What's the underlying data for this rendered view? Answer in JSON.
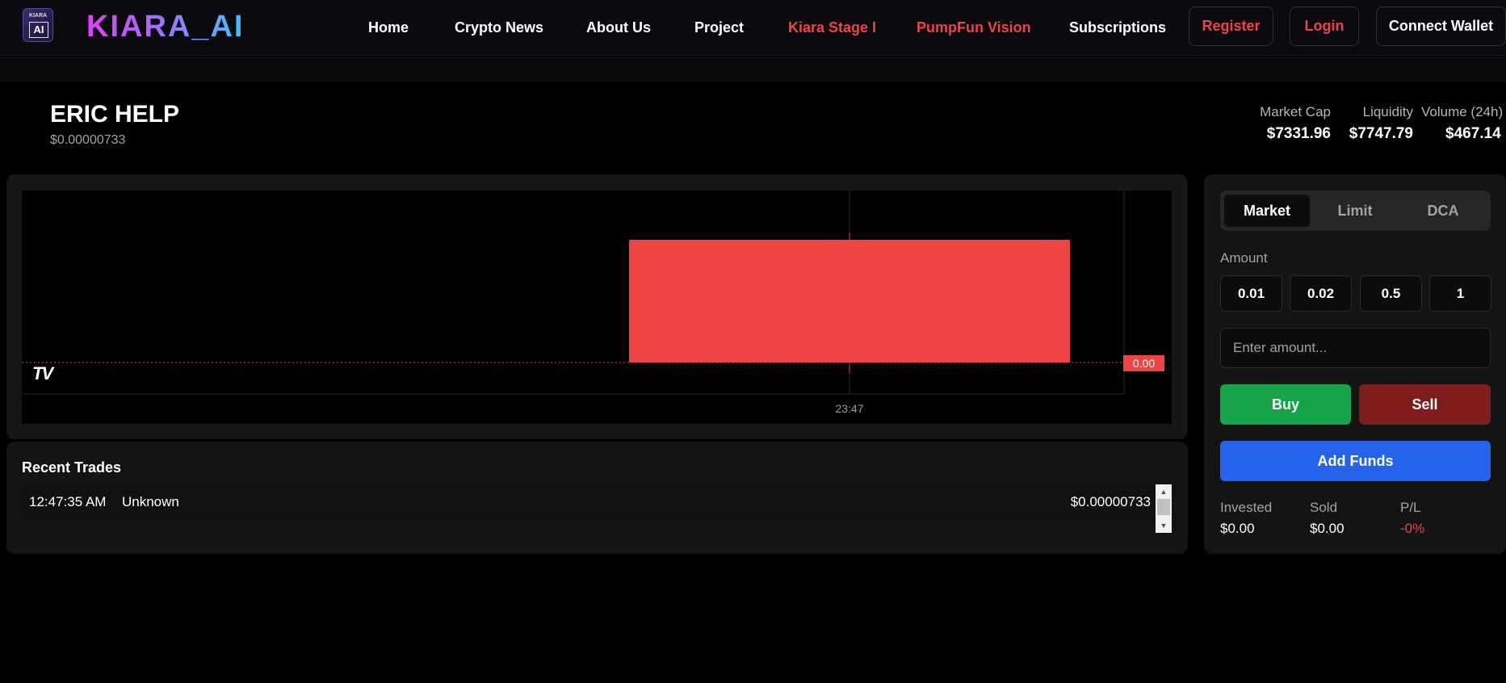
{
  "nav": {
    "logo_line1": "KIARA",
    "logo_line2": "AI",
    "brand": "KIARA_AI",
    "links": [
      "Home",
      "Crypto News",
      "About Us",
      "Project",
      "Kiara Stage I",
      "PumpFun Vision",
      "Subscriptions"
    ],
    "register": "Register",
    "login": "Login",
    "connect_wallet": "Connect Wallet"
  },
  "token": {
    "name": "ERIC HELP",
    "price": "$0.00000733",
    "stats": [
      {
        "label": "Market Cap",
        "value": "$7331.96"
      },
      {
        "label": "Liquidity",
        "value": "$7747.79"
      },
      {
        "label": "Volume (24h)",
        "value": "$467.14"
      }
    ]
  },
  "chart": {
    "watermark": "TV",
    "price_tag": "0.00",
    "time_tick": "23:47",
    "candle_color": "#ef4444"
  },
  "chart_data": {
    "type": "candlestick",
    "x": [
      "23:47"
    ],
    "series": [
      {
        "open": 7.33e-06,
        "close": 7.33e-06
      }
    ],
    "last_price_label": "0.00"
  },
  "trades": {
    "title": "Recent Trades",
    "rows": [
      {
        "time": "12:47:35 AM",
        "who": "Unknown",
        "price": "$0.00000733"
      }
    ]
  },
  "order": {
    "tabs": [
      "Market",
      "Limit",
      "DCA"
    ],
    "active_tab": "Market",
    "amount_label": "Amount",
    "presets": [
      "0.01",
      "0.02",
      "0.5",
      "1"
    ],
    "amount_placeholder": "Enter amount...",
    "buy": "Buy",
    "sell": "Sell",
    "add_funds": "Add Funds",
    "summary": [
      {
        "label": "Invested",
        "value": "$0.00"
      },
      {
        "label": "Sold",
        "value": "$0.00"
      },
      {
        "label": "P/L",
        "value": "-0%"
      }
    ]
  },
  "colors": {
    "brand_gradient_start": "#e040fb",
    "brand_gradient_end": "#3fc1ff",
    "accent_red": "#ef4444",
    "buy_green": "#16a34a",
    "sell_red": "#7f1d1d",
    "funds_blue": "#2563eb"
  }
}
